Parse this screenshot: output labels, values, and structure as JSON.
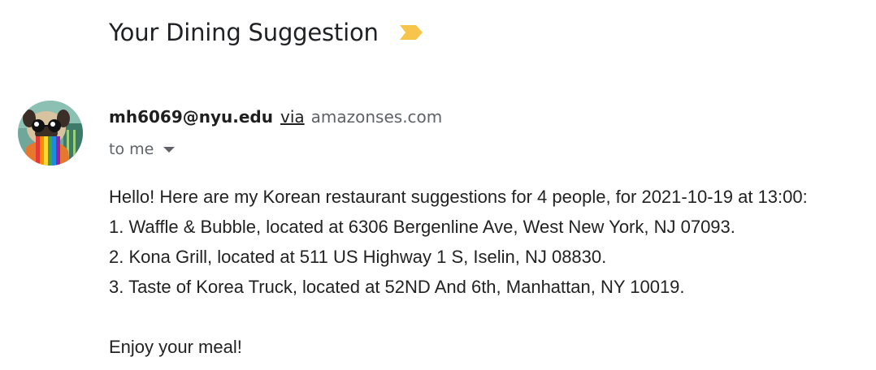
{
  "email": {
    "subject": "Your Dining Suggestion",
    "importance_marker": "label-important-icon",
    "importance_color": "#f7c54b",
    "sender": {
      "email": "mh6069@nyu.edu",
      "via_label": "via",
      "via_domain": "amazonses.com",
      "avatar": "pug-avatar"
    },
    "recipient": {
      "label": "to me",
      "dropdown_icon": "caret-down-icon"
    },
    "body": {
      "intro": "Hello! Here are my Korean restaurant suggestions for 4 people, for 2021-10-19 at 13:00:",
      "suggestions": [
        "1. Waffle & Bubble, located at 6306 Bergenline Ave, West New York, NJ 07093.",
        "2. Kona Grill, located at 511 US Highway 1 S, Iselin, NJ 08830.",
        "3. Taste of Korea Truck, located at 52ND And 6th, Manhattan, NY 10019."
      ],
      "closing": "Enjoy your meal!"
    }
  }
}
